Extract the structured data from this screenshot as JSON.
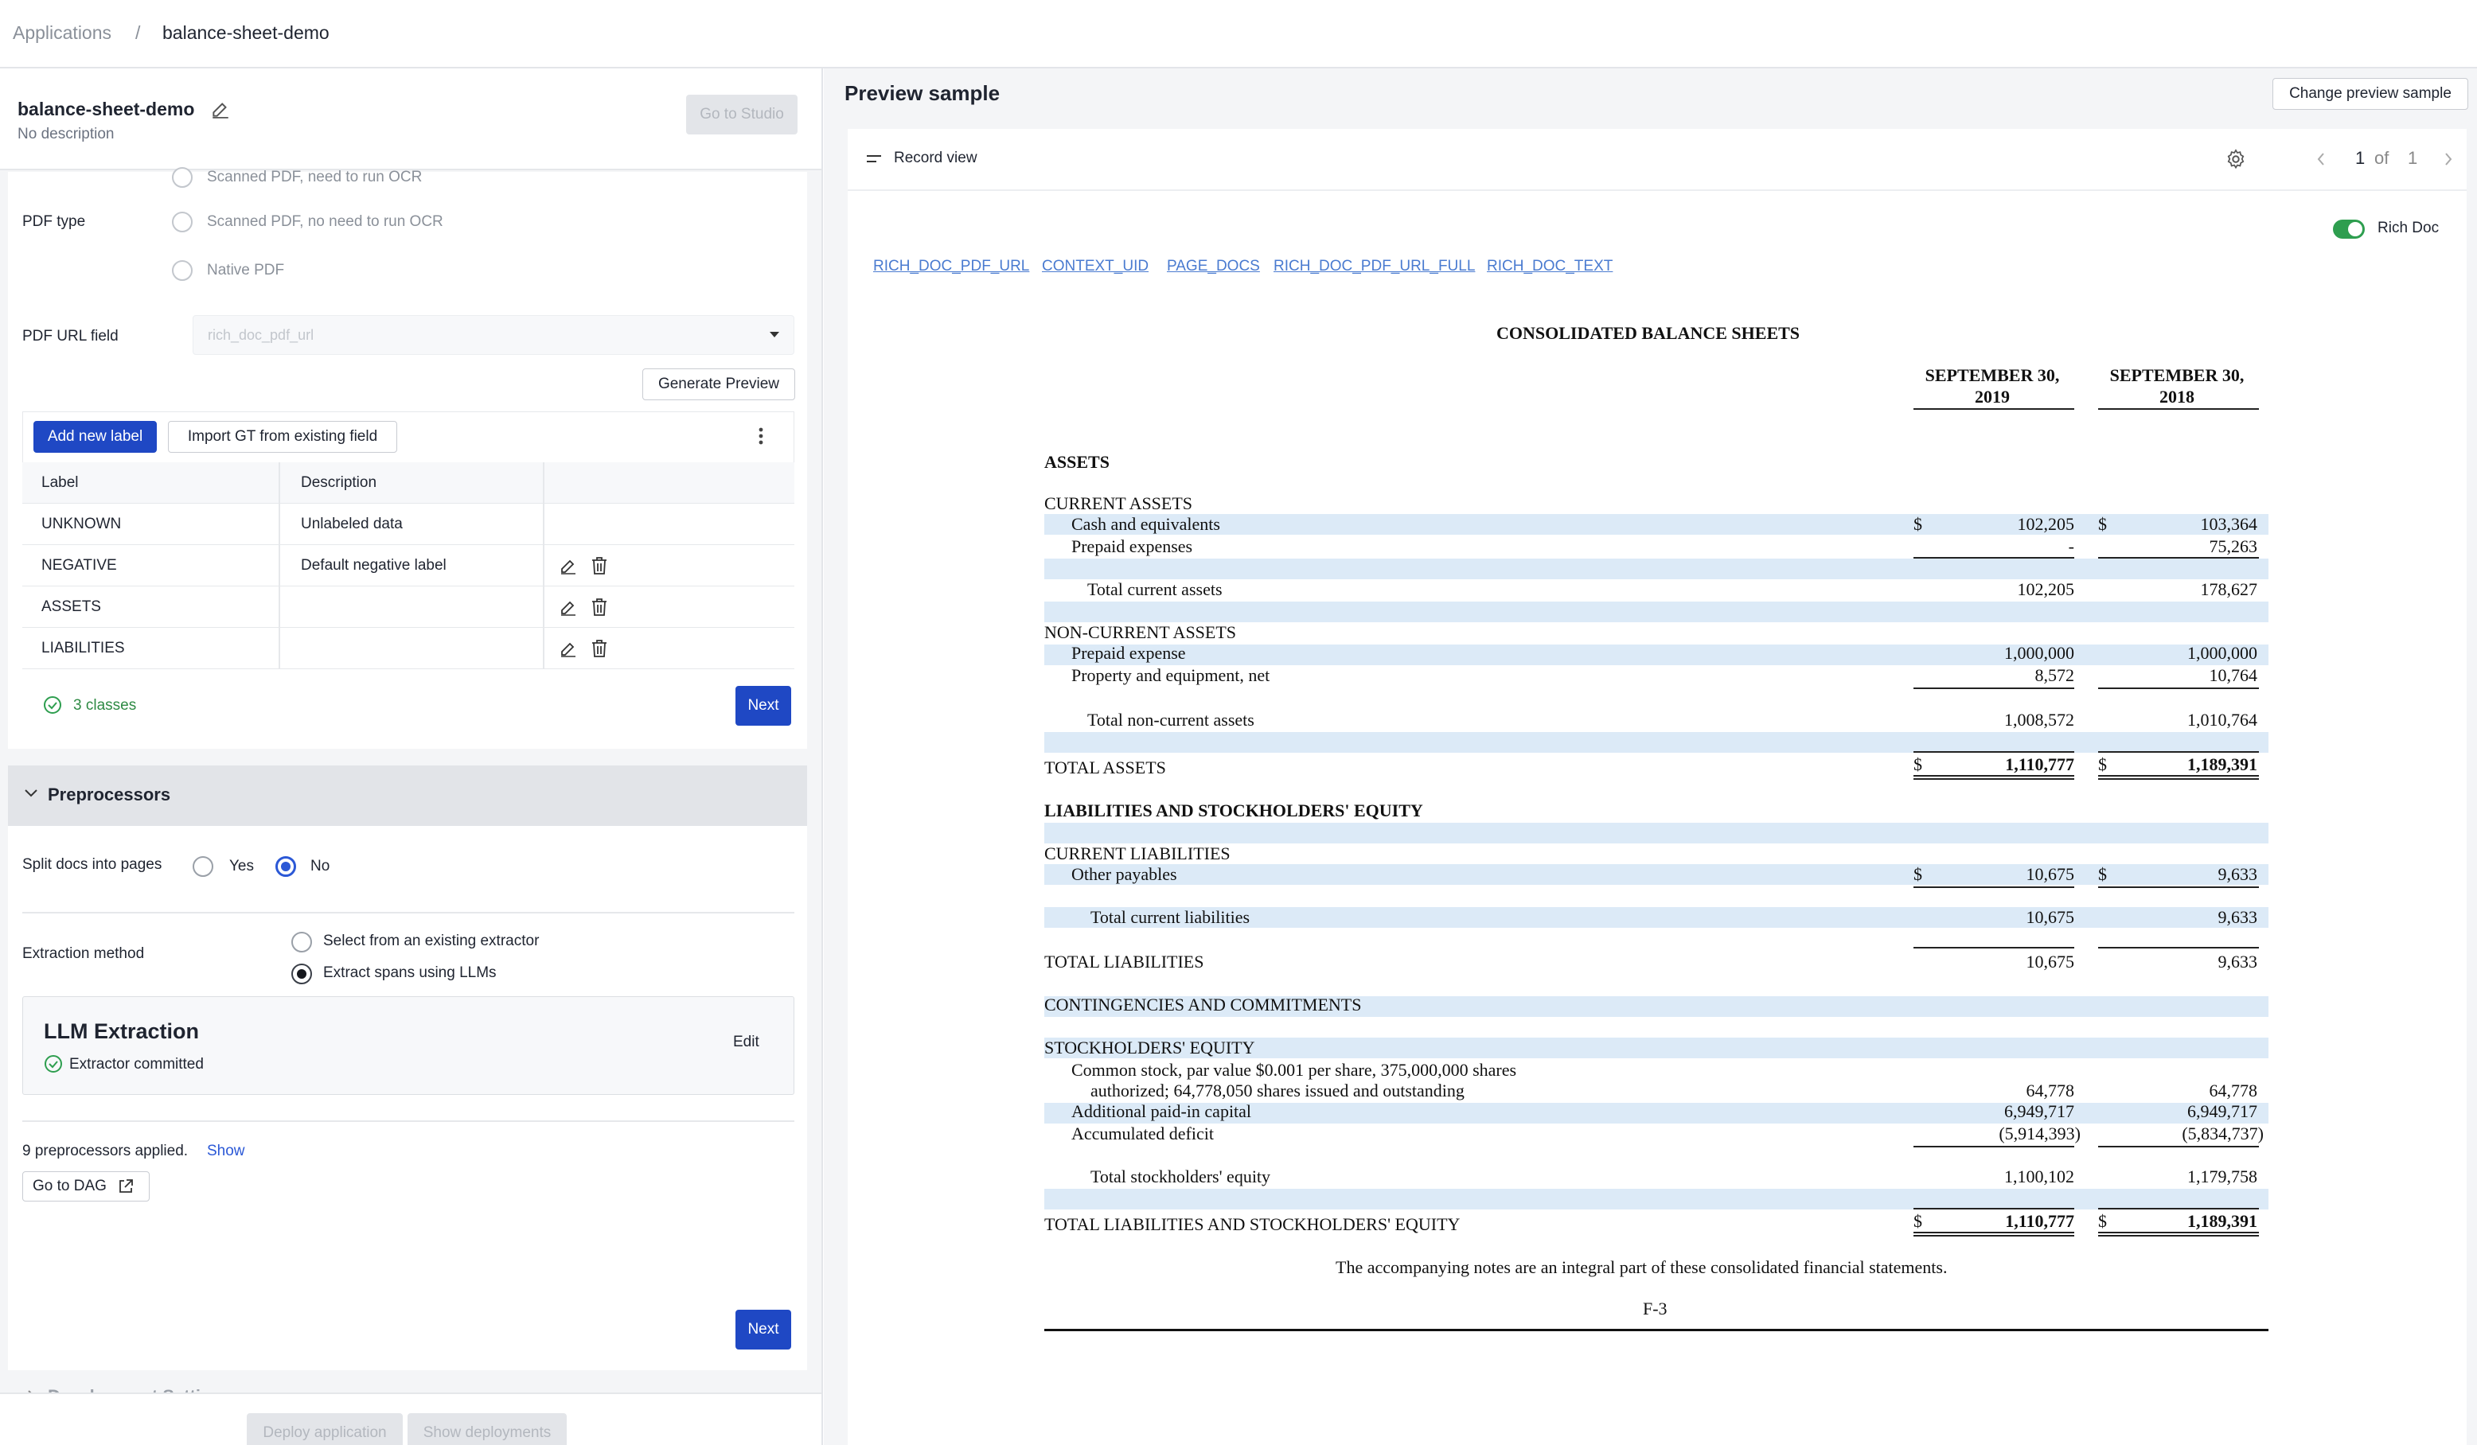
{
  "breadcrumb": {
    "root": "Applications",
    "sep": "/",
    "current": "balance-sheet-demo"
  },
  "app": {
    "name": "balance-sheet-demo",
    "description": "No description",
    "studio_button": "Go to Studio"
  },
  "pdf_section": {
    "cut_option": "Scanned PDF, need to run OCR",
    "pdf_type_label": "PDF type",
    "options": [
      "Scanned PDF, no need to run OCR",
      "Native PDF"
    ],
    "url_field_label": "PDF URL field",
    "url_field_value": "rich_doc_pdf_url",
    "generate_preview": "Generate Preview"
  },
  "labels": {
    "add_button": "Add new label",
    "import_button": "Import GT from existing field",
    "headers": [
      "Label",
      "Description"
    ],
    "rows": [
      {
        "label": "UNKNOWN",
        "description": "Unlabeled data",
        "editable": false
      },
      {
        "label": "NEGATIVE",
        "description": "Default negative label",
        "editable": true
      },
      {
        "label": "ASSETS",
        "description": "",
        "editable": true
      },
      {
        "label": "LIABILITIES",
        "description": "",
        "editable": true
      }
    ],
    "count": "3 classes",
    "next": "Next"
  },
  "preprocessors": {
    "title": "Preprocessors",
    "split_label": "Split docs into pages",
    "split_yes": "Yes",
    "split_no": "No",
    "split_selected": "No",
    "extraction_label": "Extraction method",
    "extraction_options": [
      "Select from an existing extractor",
      "Extract spans using LLMs"
    ],
    "extraction_selected": "Extract spans using LLMs",
    "llm_title": "LLM Extraction",
    "llm_status": "Extractor committed",
    "llm_edit": "Edit",
    "applied_text": "9 preprocessors applied.",
    "applied_show": "Show",
    "dag_button": "Go to DAG",
    "next": "Next"
  },
  "dev_settings": "Development Settings",
  "footer": {
    "deploy": "Deploy application",
    "deployments": "Show deployments"
  },
  "preview": {
    "title": "Preview sample",
    "change_button": "Change preview sample",
    "record_view": "Record view",
    "pager_current": "1",
    "pager_of": "of",
    "pager_total": "1",
    "rich_doc_label": "Rich Doc",
    "rich_doc_on": true,
    "field_links": [
      "RICH_DOC_PDF_URL",
      "CONTEXT_UID",
      "PAGE_DOCS",
      "RICH_DOC_PDF_URL_FULL",
      "RICH_DOC_TEXT"
    ]
  },
  "document": {
    "title": "CONSOLIDATED BALANCE SHEETS",
    "col1": [
      "SEPTEMBER 30,",
      "2019"
    ],
    "col2": [
      "SEPTEMBER 30,",
      "2018"
    ],
    "dollar": "$",
    "assets": "ASSETS",
    "current_assets": "CURRENT ASSETS",
    "cash": {
      "label": "Cash and equivalents",
      "v2019": "102,205",
      "v2018": "103,364"
    },
    "prepaid": {
      "label": "Prepaid expenses",
      "v2019": "-",
      "v2018": "75,263"
    },
    "total_current_assets": {
      "label": "Total current assets",
      "v2019": "102,205",
      "v2018": "178,627"
    },
    "non_current_assets": "NON-CURRENT ASSETS",
    "prepaid_expense": {
      "label": "Prepaid expense",
      "v2019": "1,000,000",
      "v2018": "1,000,000"
    },
    "ppe": {
      "label": "Property and equipment, net",
      "v2019": "8,572",
      "v2018": "10,764"
    },
    "total_non_current": {
      "label": "Total non-current assets",
      "v2019": "1,008,572",
      "v2018": "1,010,764"
    },
    "total_assets": {
      "label": "TOTAL ASSETS",
      "v2019": "1,110,777",
      "v2018": "1,189,391"
    },
    "liab_equity_heading": "LIABILITIES AND STOCKHOLDERS' EQUITY",
    "current_liabilities": "CURRENT LIABILITIES",
    "other_payables": {
      "label": "Other payables",
      "v2019": "10,675",
      "v2018": "9,633"
    },
    "total_current_liabilities": {
      "label": "Total current liabilities",
      "v2019": "10,675",
      "v2018": "9,633"
    },
    "total_liabilities": {
      "label": "TOTAL LIABILITIES",
      "v2019": "10,675",
      "v2018": "9,633"
    },
    "contingencies": "CONTINGENCIES AND COMMITMENTS",
    "stockholders_equity": "STOCKHOLDERS' EQUITY",
    "common_stock_1": "Common stock, par value $0.001 per share, 375,000,000 shares",
    "common_stock_2": "authorized; 64,778,050 shares issued and outstanding",
    "common_stock_v2019": "64,778",
    "common_stock_v2018": "64,778",
    "apic": {
      "label": "Additional paid-in capital",
      "v2019": "6,949,717",
      "v2018": "6,949,717"
    },
    "deficit": {
      "label": "Accumulated deficit",
      "v2019": "(5,914,393)",
      "v2018": "(5,834,737)"
    },
    "total_equity": {
      "label": "Total stockholders' equity",
      "v2019": "1,100,102",
      "v2018": "1,179,758"
    },
    "total_liab_equity": {
      "label": "TOTAL LIABILITIES AND STOCKHOLDERS' EQUITY",
      "v2019": "1,110,777",
      "v2018": "1,189,391"
    },
    "note": "The accompanying notes are an integral part of these consolidated financial statements.",
    "page": "F-3"
  }
}
